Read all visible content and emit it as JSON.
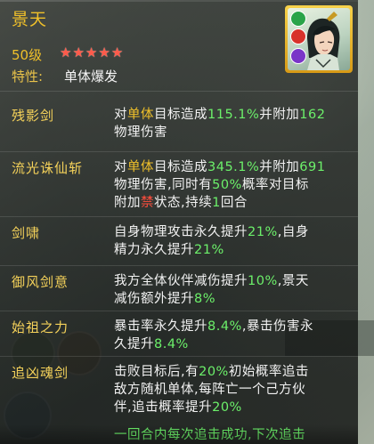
{
  "hero": {
    "name": "景天",
    "level": "50级",
    "stars": 5,
    "star_glyph": "★",
    "trait_label": "特性:",
    "trait_value": "单体爆发",
    "avatar": "hero-portrait"
  },
  "skills": [
    {
      "name": "残影剑",
      "desc": [
        {
          "t": "对",
          "c": "n"
        },
        {
          "t": "单体",
          "c": "g"
        },
        {
          "t": "目标造成",
          "c": "n"
        },
        {
          "t": "115.1%",
          "c": "gr"
        },
        {
          "t": "并附加",
          "c": "n"
        },
        {
          "t": "162",
          "c": "gr"
        },
        {
          "t": "\n物理伤害",
          "c": "n"
        }
      ]
    },
    {
      "name": "流光诛仙斩",
      "desc": [
        {
          "t": "对",
          "c": "n"
        },
        {
          "t": "单体",
          "c": "g"
        },
        {
          "t": "目标造成",
          "c": "n"
        },
        {
          "t": "345.1%",
          "c": "gr"
        },
        {
          "t": "并附加",
          "c": "n"
        },
        {
          "t": "691",
          "c": "gr"
        },
        {
          "t": "\n物理伤害,同时有",
          "c": "n"
        },
        {
          "t": "50%",
          "c": "gr"
        },
        {
          "t": "概率对目标",
          "c": "n"
        },
        {
          "t": "\n附加",
          "c": "n"
        },
        {
          "t": "禁",
          "c": "r"
        },
        {
          "t": "状态,持续",
          "c": "n"
        },
        {
          "t": "1",
          "c": "gr"
        },
        {
          "t": "回合",
          "c": "n"
        }
      ]
    },
    {
      "name": "剑啸",
      "desc": [
        {
          "t": "自身物理攻击永久提升",
          "c": "n"
        },
        {
          "t": "21%",
          "c": "gr"
        },
        {
          "t": ",自身",
          "c": "n"
        },
        {
          "t": "\n精力永久提升",
          "c": "n"
        },
        {
          "t": "21%",
          "c": "gr"
        }
      ]
    },
    {
      "name": "御风剑意",
      "desc": [
        {
          "t": "我方全体伙伴减伤提升",
          "c": "n"
        },
        {
          "t": "10%",
          "c": "gr"
        },
        {
          "t": ",景天",
          "c": "n"
        },
        {
          "t": "\n减伤额外提升",
          "c": "n"
        },
        {
          "t": "8%",
          "c": "gr"
        }
      ]
    },
    {
      "name": "始祖之力",
      "desc": [
        {
          "t": "暴击率永久提升",
          "c": "n"
        },
        {
          "t": "8.4%",
          "c": "gr"
        },
        {
          "t": ",暴击伤害永",
          "c": "n"
        },
        {
          "t": "\n久提升",
          "c": "n"
        },
        {
          "t": "8.4%",
          "c": "gr"
        }
      ]
    },
    {
      "name": "追凶魂剑",
      "desc": [
        {
          "t": "击败目标后,有",
          "c": "n"
        },
        {
          "t": "20%",
          "c": "gr"
        },
        {
          "t": "初始概率追击",
          "c": "n"
        },
        {
          "t": "\n敌方随机单体,每阵亡一个己方伙",
          "c": "n"
        },
        {
          "t": "\n伴,追击概率提升",
          "c": "n"
        },
        {
          "t": "20%",
          "c": "gr"
        }
      ]
    }
  ],
  "last_line": "一回合内每次追击成功,下次追击",
  "colors": {
    "gold": "#f0c02a",
    "green": "#6cf06a",
    "red": "#ff4d3d",
    "text": "#f2f2f2",
    "star": "#ff5a4a"
  }
}
